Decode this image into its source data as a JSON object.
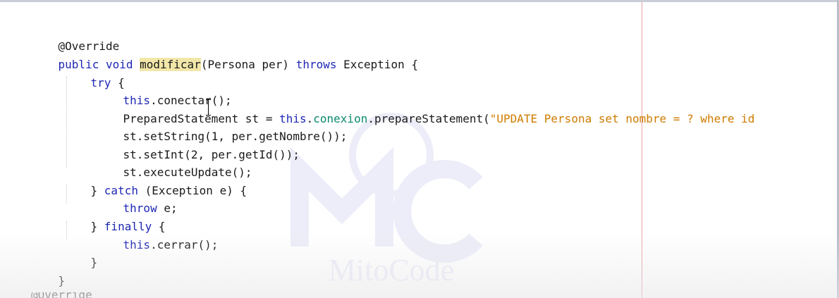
{
  "editor": {
    "code": {
      "l1_annotation": "@Override",
      "l2_public_void": "public void ",
      "l2_method": "modificar",
      "l2_params": "(Persona per) ",
      "l2_throws": "throws",
      "l2_exception": " Exception {",
      "l3_try": "try",
      "l3_brace": " {",
      "l4_this": "this",
      "l4_rest": ".conectar();",
      "l5_decl": "PreparedStatement st = ",
      "l5_this": "this",
      "l5_dot": ".",
      "l5_field": "conexion",
      "l5_call": ".prepareStatement(",
      "l5_string": "\"UPDATE Persona set nombre = ? where id",
      "l6_code": "st.setString(1, per.getNombre());",
      "l7_code": "st.setInt(2, per.getId());",
      "l8_code": "st.executeUpdate();",
      "l9_open": "} ",
      "l9_catch": "catch",
      "l9_rest": " (Exception e) {",
      "l10_throw": "throw",
      "l10_rest": " e;",
      "l11_open": "} ",
      "l11_finally": "finally",
      "l11_rest": " {",
      "l12_this": "this",
      "l12_rest": ".cerrar();",
      "l13_close": "}",
      "l14_close": "}",
      "peek_next": "@Override"
    },
    "watermark_text": "MitoCode",
    "colors": {
      "keyword": "#1e28b4",
      "field": "#0a8a6e",
      "string": "#ce7b00",
      "highlight": "#f2e7a8",
      "margin_line": "#e7a0a6"
    }
  }
}
